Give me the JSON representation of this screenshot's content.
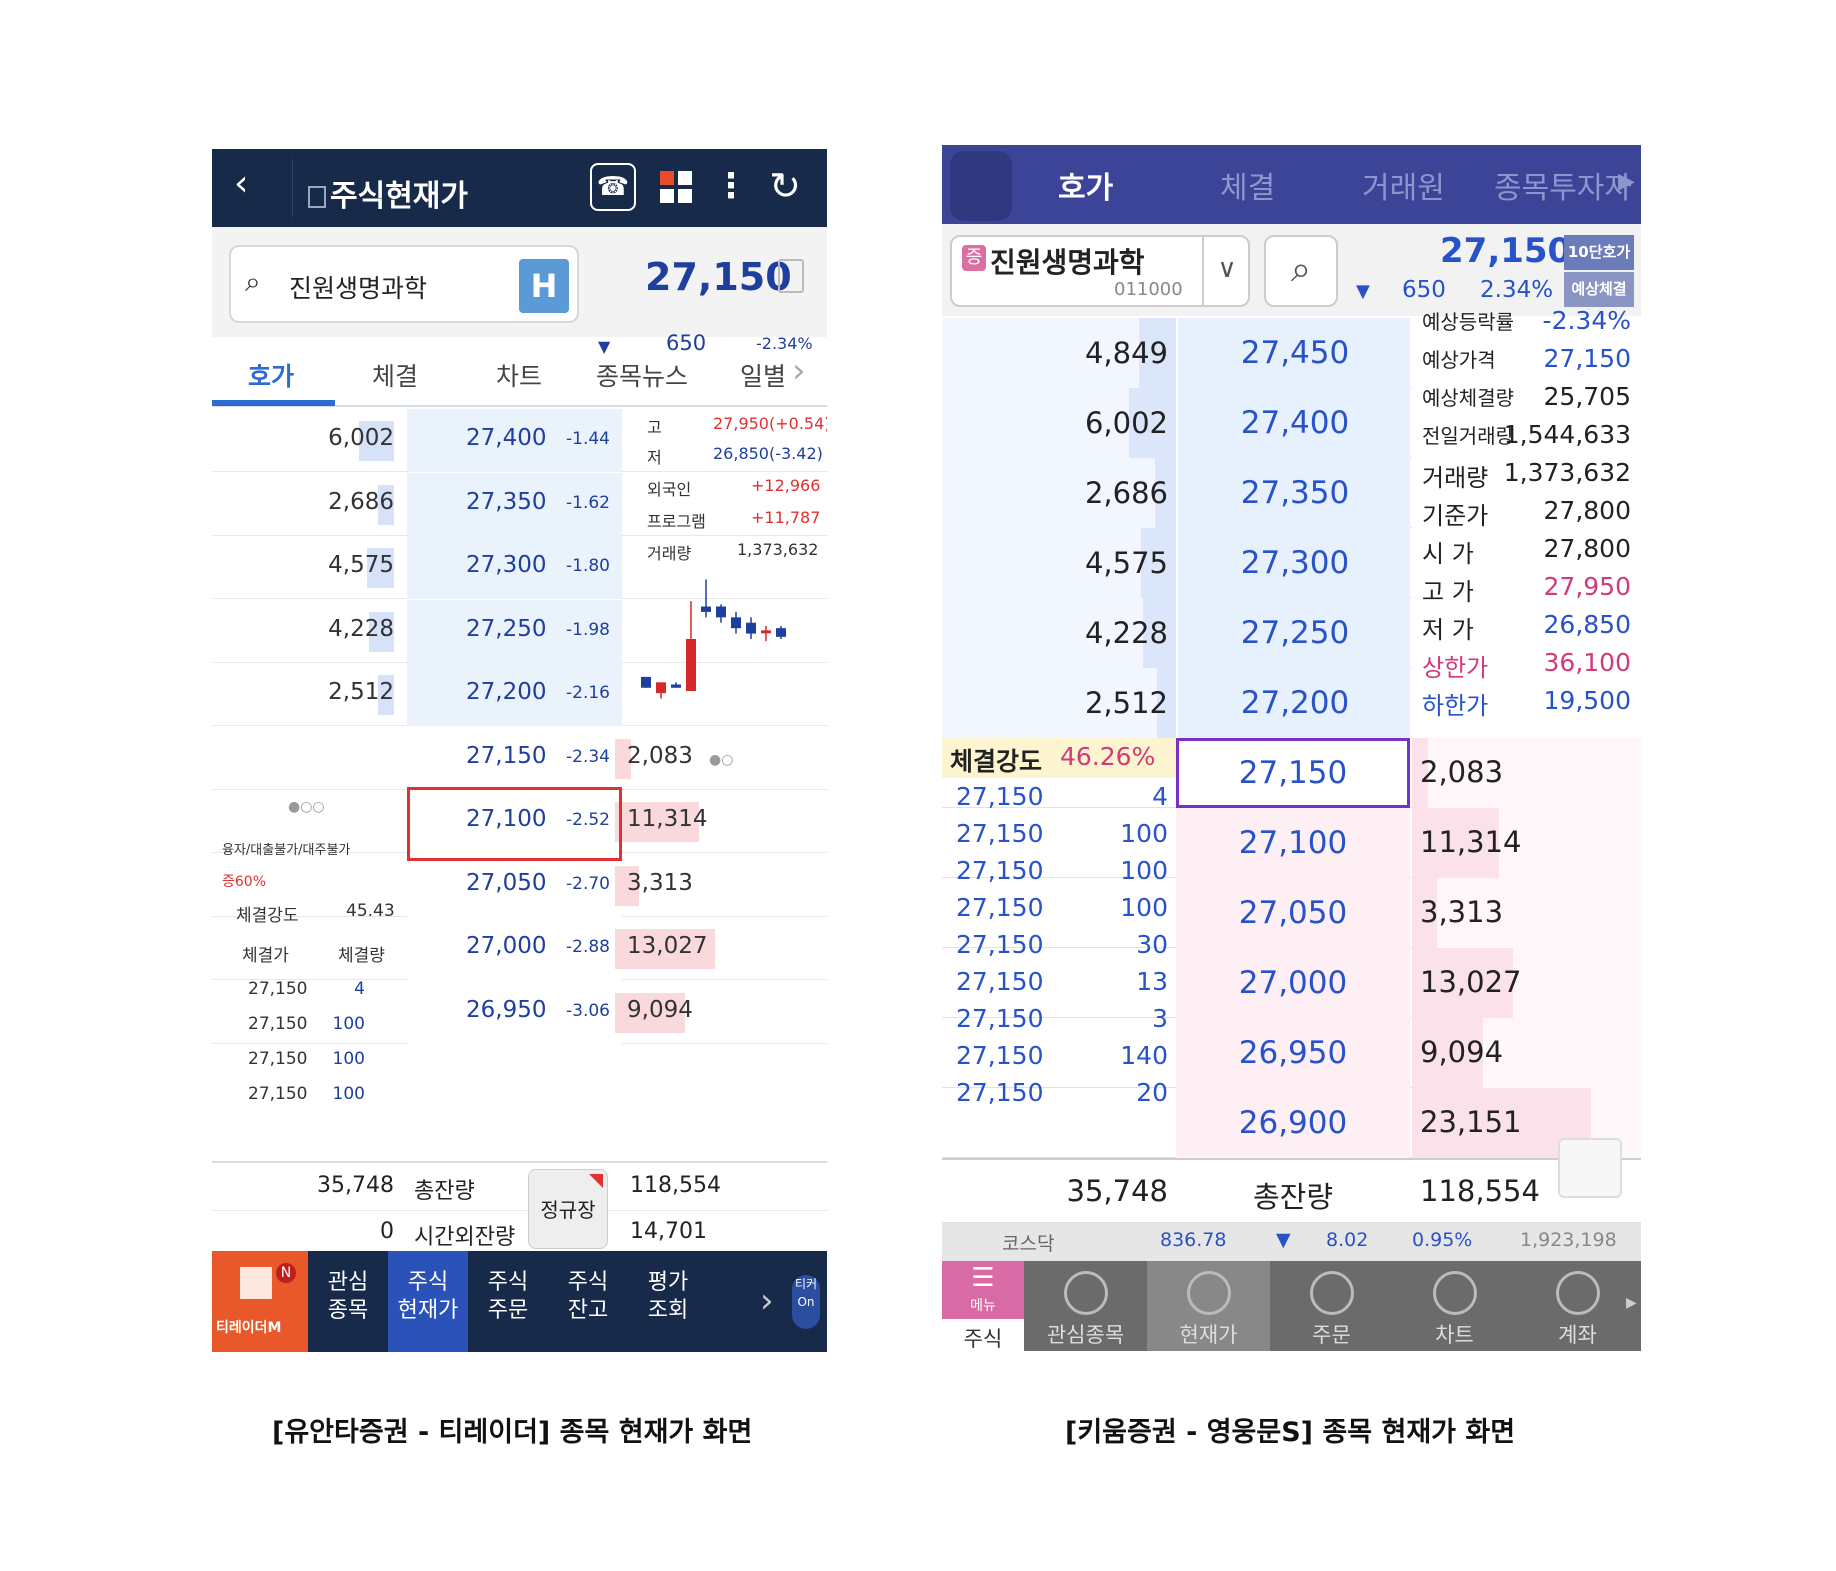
{
  "left_app": {
    "title": "주식현재가",
    "stock_name": "진원생명과학",
    "h_badge": "H",
    "price": "27,150",
    "change": "650",
    "change_pct": "-2.34%",
    "tabs": [
      "호가",
      "체결",
      "차트",
      "종목뉴스",
      "일별"
    ],
    "ask_rows": [
      {
        "vol": "6,002",
        "price": "27,400",
        "pct": "-1.44",
        "bar": 0.18
      },
      {
        "vol": "2,686",
        "price": "27,350",
        "pct": "-1.62",
        "bar": 0.08
      },
      {
        "vol": "4,575",
        "price": "27,300",
        "pct": "-1.80",
        "bar": 0.14
      },
      {
        "vol": "4,228",
        "price": "27,250",
        "pct": "-1.98",
        "bar": 0.13
      },
      {
        "vol": "2,512",
        "price": "27,200",
        "pct": "-2.16",
        "bar": 0.08
      }
    ],
    "bid_rows": [
      {
        "vol": "2,083",
        "price": "27,150",
        "pct": "-2.34",
        "bar": 0.08
      },
      {
        "vol": "11,314",
        "price": "27,100",
        "pct": "-2.52",
        "bar": 0.42
      },
      {
        "vol": "3,313",
        "price": "27,050",
        "pct": "-2.70",
        "bar": 0.12
      },
      {
        "vol": "13,027",
        "price": "27,000",
        "pct": "-2.88",
        "bar": 0.5
      },
      {
        "vol": "9,094",
        "price": "26,950",
        "pct": "-3.06",
        "bar": 0.35
      }
    ],
    "info": {
      "high_label": "고",
      "high": "27,950(+0.54)",
      "low_label": "저",
      "low": "26,850(-3.42)",
      "foreign_label": "외국인",
      "foreign": "+12,966",
      "program_label": "프로그램",
      "program": "+11,787",
      "volume_label": "거래량",
      "volume": "1,373,632"
    },
    "credit_note": "융자/대출불가/대주불가",
    "margin": "증60%",
    "strength_label": "체결강도",
    "strength": "45.43",
    "trade_price_label": "체결가",
    "trade_qty_label": "체결량",
    "trades": [
      {
        "price": "27,150",
        "qty": "4"
      },
      {
        "price": "27,150",
        "qty": "100"
      },
      {
        "price": "27,150",
        "qty": "100"
      },
      {
        "price": "27,150",
        "qty": "100"
      }
    ],
    "total_ask": "35,748",
    "total_label": "총잔량",
    "total_bid": "118,554",
    "after_ask": "0",
    "after_label": "시간외잔량",
    "after_bid": "14,701",
    "session_btn": "정규장",
    "nav": [
      {
        "l1": "관심",
        "l2": "종목"
      },
      {
        "l1": "주식",
        "l2": "현재가"
      },
      {
        "l1": "주식",
        "l2": "주문"
      },
      {
        "l1": "주식",
        "l2": "잔고"
      },
      {
        "l1": "평가",
        "l2": "조회"
      }
    ],
    "logo_text": "티레이더M",
    "logo_badge": "N",
    "ticker_l1": "티커",
    "ticker_l2": "On",
    "candles": [
      {
        "o": 26950,
        "c": 27050,
        "h": 27050,
        "l": 26950,
        "up": false
      },
      {
        "o": 27000,
        "c": 26900,
        "h": 27000,
        "l": 26850,
        "up": true
      },
      {
        "o": 26950,
        "c": 26980,
        "h": 27000,
        "l": 26950,
        "up": false
      },
      {
        "o": 26920,
        "c": 27400,
        "h": 27750,
        "l": 26920,
        "up": true
      },
      {
        "o": 27700,
        "c": 27650,
        "h": 27950,
        "l": 27600,
        "up": false
      },
      {
        "o": 27700,
        "c": 27600,
        "h": 27720,
        "l": 27550,
        "up": false
      },
      {
        "o": 27600,
        "c": 27500,
        "h": 27650,
        "l": 27450,
        "up": false
      },
      {
        "o": 27550,
        "c": 27450,
        "h": 27600,
        "l": 27400,
        "up": false
      },
      {
        "o": 27480,
        "c": 27480,
        "h": 27520,
        "l": 27380,
        "up": true
      },
      {
        "o": 27500,
        "c": 27420,
        "h": 27520,
        "l": 27400,
        "up": false
      }
    ]
  },
  "right_app": {
    "tabs": [
      "호가",
      "체결",
      "거래원",
      "종목투자자"
    ],
    "stock_badge": "증",
    "stock_name": "진원생명과학",
    "stock_code": "011000",
    "price": "27,150",
    "change": "650",
    "change_pct": "2.34%",
    "btn1": "10단호가",
    "btn2": "예상체결",
    "ask_rows": [
      {
        "vol": "4,849",
        "price": "27,450",
        "bar": 0.16
      },
      {
        "vol": "6,002",
        "price": "27,400",
        "bar": 0.2
      },
      {
        "vol": "2,686",
        "price": "27,350",
        "bar": 0.09
      },
      {
        "vol": "4,575",
        "price": "27,300",
        "bar": 0.15
      },
      {
        "vol": "4,228",
        "price": "27,250",
        "bar": 0.14
      },
      {
        "vol": "2,512",
        "price": "27,200",
        "bar": 0.08
      }
    ],
    "bid_rows": [
      {
        "vol": "2,083",
        "price": "27,150",
        "bar": 0.07
      },
      {
        "vol": "11,314",
        "price": "27,100",
        "bar": 0.38
      },
      {
        "vol": "3,313",
        "price": "27,050",
        "bar": 0.11
      },
      {
        "vol": "13,027",
        "price": "27,000",
        "bar": 0.44
      },
      {
        "vol": "9,094",
        "price": "26,950",
        "bar": 0.31
      },
      {
        "vol": "23,151",
        "price": "26,900",
        "bar": 0.78
      }
    ],
    "info": [
      {
        "label": "예상등락률",
        "value": "-2.34%",
        "lc": "#222",
        "vc": "#2852c8"
      },
      {
        "label": "예상가격",
        "value": "27,150",
        "lc": "#222",
        "vc": "#2852c8"
      },
      {
        "label": "예상체결량",
        "value": "25,705",
        "lc": "#222",
        "vc": "#222"
      },
      {
        "label": "전일거래량",
        "value": "1,544,633",
        "lc": "#222",
        "vc": "#222"
      },
      {
        "label": "거래량",
        "value": "1,373,632",
        "lc": "#222",
        "vc": "#222"
      },
      {
        "label": "기준가",
        "value": "27,800",
        "lc": "#222",
        "vc": "#222"
      },
      {
        "label": "시 가",
        "value": "27,800",
        "lc": "#222",
        "vc": "#222"
      },
      {
        "label": "고 가",
        "value": "27,950",
        "lc": "#222",
        "vc": "#d23a7a"
      },
      {
        "label": "저 가",
        "value": "26,850",
        "lc": "#222",
        "vc": "#2852c8"
      },
      {
        "label": "상한가",
        "value": "36,100",
        "lc": "#d23a7a",
        "vc": "#d23a7a"
      },
      {
        "label": "하한가",
        "value": "19,500",
        "lc": "#2852c8",
        "vc": "#2852c8"
      }
    ],
    "strength_label": "체결강도",
    "strength": "46.26%",
    "trades": [
      {
        "price": "27,150",
        "qty": "4"
      },
      {
        "price": "27,150",
        "qty": "100"
      },
      {
        "price": "27,150",
        "qty": "100"
      },
      {
        "price": "27,150",
        "qty": "100"
      },
      {
        "price": "27,150",
        "qty": "30"
      },
      {
        "price": "27,150",
        "qty": "13"
      },
      {
        "price": "27,150",
        "qty": "3"
      },
      {
        "price": "27,150",
        "qty": "140"
      },
      {
        "price": "27,150",
        "qty": "20"
      }
    ],
    "total_ask": "35,748",
    "total_label": "총잔량",
    "total_bid": "118,554",
    "status": {
      "market": "코스닥",
      "index": "836.78",
      "chg": "8.02",
      "pct": "0.95%",
      "vol": "1,923,198"
    },
    "nav": [
      {
        "label": "주식",
        "icon": "menu-icon"
      },
      {
        "label": "관심종목",
        "icon": "star-icon"
      },
      {
        "label": "현재가",
        "icon": "price-icon"
      },
      {
        "label": "주문",
        "icon": "order-icon"
      },
      {
        "label": "차트",
        "icon": "chart-icon"
      },
      {
        "label": "계좌",
        "icon": "won-icon"
      }
    ],
    "menu_label": "메뉴"
  },
  "captions": {
    "left": "[유안타증권 - 티레이더] 종목 현재가 화면",
    "right": "[키움증권 - 영웅문S] 종목 현재가 화면"
  }
}
